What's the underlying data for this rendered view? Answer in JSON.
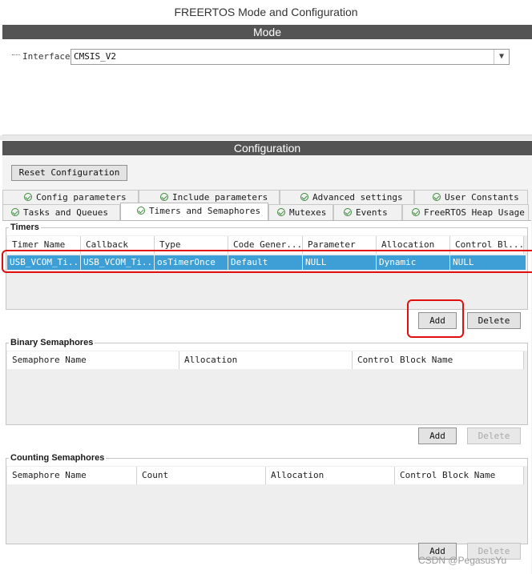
{
  "window": {
    "title": "FREERTOS Mode and Configuration"
  },
  "mode": {
    "header": "Mode",
    "interface_label": "Interface",
    "interface_value": "CMSIS_V2"
  },
  "configuration": {
    "header": "Configuration",
    "reset_button": "Reset Configuration",
    "tabs_row1": [
      "Config parameters",
      "Include parameters",
      "Advanced settings",
      "User Constants"
    ],
    "tabs_row2": [
      "Tasks and Queues",
      "Timers and Semaphores",
      "Mutexes",
      "Events",
      "FreeRTOS Heap Usage"
    ],
    "active_tab": "Timers and Semaphores"
  },
  "timers": {
    "title": "Timers",
    "columns": [
      "Timer Name",
      "Callback",
      "Type",
      "Code Gener...",
      "Parameter",
      "Allocation",
      "Control Bl..."
    ],
    "rows": [
      [
        "USB_VCOM_Ti...",
        "USB_VCOM_Ti...",
        "osTimerOnce",
        "Default",
        "NULL",
        "Dynamic",
        "NULL"
      ]
    ],
    "add_button": "Add",
    "delete_button": "Delete"
  },
  "binary_semaphores": {
    "title": "Binary Semaphores",
    "columns": [
      "Semaphore Name",
      "Allocation",
      "Control Block Name"
    ],
    "add_button": "Add",
    "delete_button": "Delete"
  },
  "counting_semaphores": {
    "title": "Counting Semaphores",
    "columns": [
      "Semaphore Name",
      "Count",
      "Allocation",
      "Control Block Name"
    ],
    "add_button": "Add",
    "delete_button": "Delete"
  },
  "watermark": "CSDN @PegasusYu",
  "colors": {
    "header_bar": "#545454",
    "selected_row": "#3d9fd6",
    "highlight": "#e01010",
    "tab_check": "#3a8a3a"
  },
  "icons": {
    "tab_status": "check-circle-icon",
    "dropdown": "chevron-down-icon"
  }
}
